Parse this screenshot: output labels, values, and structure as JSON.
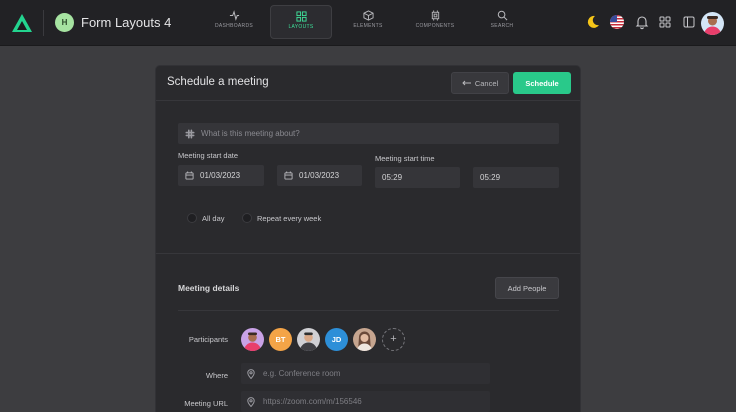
{
  "header": {
    "project_initial": "H",
    "project_title": "Form Layouts 4",
    "nav": [
      {
        "label": "DASHBOARDS",
        "icon": "activity-icon"
      },
      {
        "label": "LAYOUTS",
        "icon": "grid-icon"
      },
      {
        "label": "ELEMENTS",
        "icon": "box-icon"
      },
      {
        "label": "COMPONENTS",
        "icon": "cpu-icon"
      },
      {
        "label": "SEARCH",
        "icon": "search-icon"
      }
    ],
    "right_icons": [
      "moon-icon",
      "us-flag-icon",
      "bell-icon",
      "apps-icon",
      "sidebar-icon"
    ]
  },
  "form": {
    "title": "Schedule a meeting",
    "cancel_label": "Cancel",
    "schedule_label": "Schedule",
    "about_placeholder": "What is this meeting about?",
    "start_date_label": "Meeting start date",
    "start_time_label": "Meeting start time",
    "date_1": "01/03/2023",
    "date_2": "01/03/2023",
    "time_1": "05:29",
    "time_2": "05:29",
    "radio_allday": "All day",
    "radio_repeat": "Repeat every week"
  },
  "details": {
    "title": "Meeting details",
    "add_people_label": "Add People",
    "participants_label": "Participants",
    "participants": [
      {
        "initials": "",
        "color": "#c9a2e6"
      },
      {
        "initials": "BT",
        "color": "#f4a447"
      },
      {
        "initials": "",
        "color": "#d0d0d4"
      },
      {
        "initials": "JD",
        "color": "#2d8fd8"
      },
      {
        "initials": "",
        "color": "#c6a58f"
      }
    ],
    "add_participant": "+",
    "where_label": "Where",
    "where_placeholder": "e.g. Conference room",
    "url_label": "Meeting URL",
    "url_placeholder": "https://zoom.com/m/156546"
  },
  "colors": {
    "accent": "#29c98a",
    "page_bg": "#3d3d40",
    "card_bg": "#2a2a2d"
  }
}
